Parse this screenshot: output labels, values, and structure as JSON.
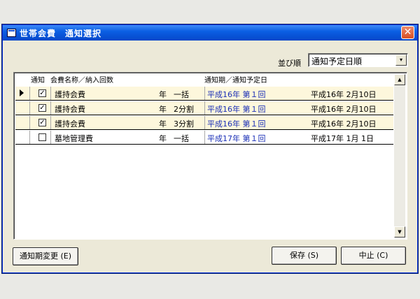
{
  "window": {
    "title": "世帯会費　通知選択",
    "close_label": "✕"
  },
  "sort": {
    "label": "並び順",
    "value": "通知予定日順",
    "arrow": "▾"
  },
  "columns": {
    "notify": "通知",
    "fee": "会費名称／納入回数",
    "period": "通知期／通知予定日"
  },
  "rows": [
    {
      "checked": "✓",
      "name": "護持会費",
      "year": "年",
      "install": "一括",
      "period": "平成16年 第１回",
      "date": "平成16年 2月10日",
      "current": true
    },
    {
      "checked": "✓",
      "name": "護持会費",
      "year": "年",
      "install": "2分割",
      "period": "平成16年 第１回",
      "date": "平成16年 2月10日",
      "current": false
    },
    {
      "checked": "✓",
      "name": "護持会費",
      "year": "年",
      "install": "3分割",
      "period": "平成16年 第１回",
      "date": "平成16年 2月10日",
      "current": false
    },
    {
      "checked": "",
      "name": "墓地管理費",
      "year": "年",
      "install": "一括",
      "period": "平成17年 第１回",
      "date": "平成17年 1月 1日",
      "current": false
    }
  ],
  "scroll": {
    "up": "▲",
    "down": "▼"
  },
  "buttons": {
    "change_period": "通知期変更 (E)",
    "save": "保存 (S)",
    "cancel": "中止 (C)"
  }
}
